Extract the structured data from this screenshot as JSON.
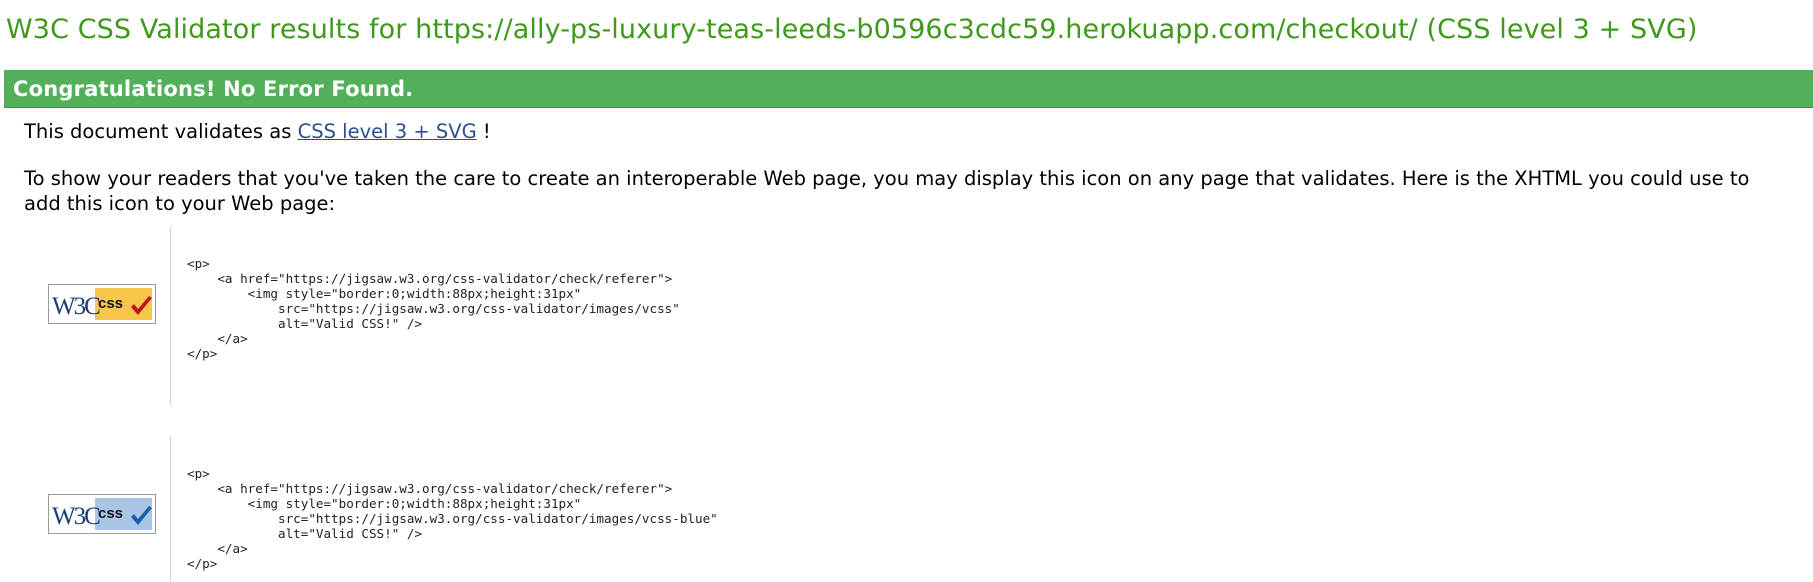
{
  "header": {
    "title": "W3C CSS Validator results for https://ally-ps-luxury-teas-leeds-b0596c3cdc59.herokuapp.com/checkout/ (CSS level 3 + SVG)"
  },
  "result": {
    "congrats": "Congratulations! No Error Found.",
    "validates_prefix": "This document validates as",
    "validates_link": "CSS level 3 + SVG",
    "validates_suffix": " !",
    "share_text": "To show your readers that you've taken the care to create an interoperable Web page, you may display this icon on any page that validates. Here is the XHTML you could use to add this icon to your Web page:"
  },
  "examples": [
    {
      "badge_variant": "gold",
      "badge_w3c": "W3C",
      "badge_css": "css",
      "badge_color": "#f7c64b",
      "check_color": "#c0141b",
      "code": "<p>\n    <a href=\"https://jigsaw.w3.org/css-validator/check/referer\">\n        <img style=\"border:0;width:88px;height:31px\"\n            src=\"https://jigsaw.w3.org/css-validator/images/vcss\"\n            alt=\"Valid CSS!\" />\n    </a>\n</p>"
    },
    {
      "badge_variant": "blue",
      "badge_w3c": "W3C",
      "badge_css": "css",
      "badge_color": "#a9c6e6",
      "check_color": "#1b5fa8",
      "code": "<p>\n    <a href=\"https://jigsaw.w3.org/css-validator/check/referer\">\n        <img style=\"border:0;width:88px;height:31px\"\n            src=\"https://jigsaw.w3.org/css-validator/images/vcss-blue\"\n            alt=\"Valid CSS!\" />\n    </a>\n</p>"
    }
  ],
  "colors": {
    "title": "#3f9a1c",
    "success_bar": "#52af5a",
    "link": "#2a4f8a"
  }
}
